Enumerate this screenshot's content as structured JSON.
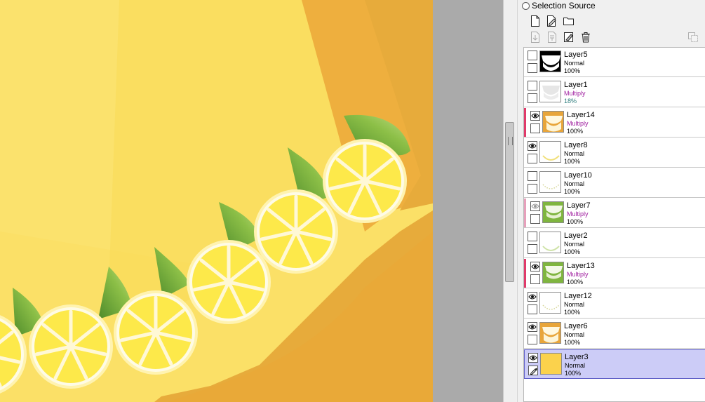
{
  "panel": {
    "selection_source_label": "Selection Source",
    "toolbar": [
      {
        "icon": "new-layer-icon"
      },
      {
        "icon": "new-linework-layer-icon"
      },
      {
        "icon": "new-folder-icon"
      },
      {
        "icon": "transfer-down-icon"
      },
      {
        "icon": "merge-down-icon"
      },
      {
        "icon": "clear-layer-icon"
      },
      {
        "icon": "delete-layer-icon"
      },
      {
        "icon": "layer-to-selection-icon"
      }
    ]
  },
  "layers": [
    {
      "name": "Layer5",
      "mode": "Normal",
      "opacity": "100%",
      "visible": false,
      "locked": false,
      "clip_color": null,
      "thumb": "white-fan-on-black",
      "selected": false
    },
    {
      "name": "Layer1",
      "mode": "Multiply",
      "opacity": "18%",
      "visible": false,
      "locked": false,
      "clip_color": null,
      "thumb": "faint-gray-fan",
      "selected": false
    },
    {
      "name": "Layer14",
      "mode": "Multiply",
      "opacity": "100%",
      "visible": true,
      "locked": false,
      "clip_color": "#e03a6a",
      "thumb": "orange-with-white-fan",
      "selected": false
    },
    {
      "name": "Layer8",
      "mode": "Normal",
      "opacity": "100%",
      "visible": true,
      "locked": false,
      "clip_color": null,
      "thumb": "faint-yellow-arc",
      "selected": false
    },
    {
      "name": "Layer10",
      "mode": "Normal",
      "opacity": "100%",
      "visible": false,
      "locked": false,
      "clip_color": null,
      "thumb": "dotted-arc",
      "selected": false
    },
    {
      "name": "Layer7",
      "mode": "Multiply",
      "opacity": "100%",
      "visible": true,
      "visible_dim": true,
      "locked": false,
      "clip_color": "#e6a0bb",
      "thumb": "green-with-white-fan",
      "selected": false
    },
    {
      "name": "Layer2",
      "mode": "Normal",
      "opacity": "100%",
      "visible": false,
      "locked": false,
      "clip_color": null,
      "thumb": "faint-green-arc",
      "selected": false
    },
    {
      "name": "Layer13",
      "mode": "Multiply",
      "opacity": "100%",
      "visible": true,
      "locked": false,
      "clip_color": "#e03a6a",
      "thumb": "green-with-white-fan",
      "selected": false
    },
    {
      "name": "Layer12",
      "mode": "Normal",
      "opacity": "100%",
      "visible": true,
      "locked": false,
      "clip_color": null,
      "thumb": "dotted-arc",
      "selected": false
    },
    {
      "name": "Layer6",
      "mode": "Normal",
      "opacity": "100%",
      "visible": true,
      "locked": false,
      "clip_color": null,
      "thumb": "orange-with-white-fan",
      "selected": false
    },
    {
      "name": "Layer3",
      "mode": "Normal",
      "opacity": "100%",
      "visible": true,
      "locked": true,
      "clip_color": null,
      "thumb": "solid-yellow",
      "selected": true
    }
  ],
  "colors": {
    "multiply_text": "#a020a0",
    "normal_text": "#000000",
    "opacity_multiply_text": "#2e7d7d",
    "selected_row": "#ccccf7",
    "canvas_light": "#fbe067",
    "canvas_orange": "#e7ab3b",
    "lemon_fill": "#fde94a",
    "leaf_green": "#78a93a"
  }
}
